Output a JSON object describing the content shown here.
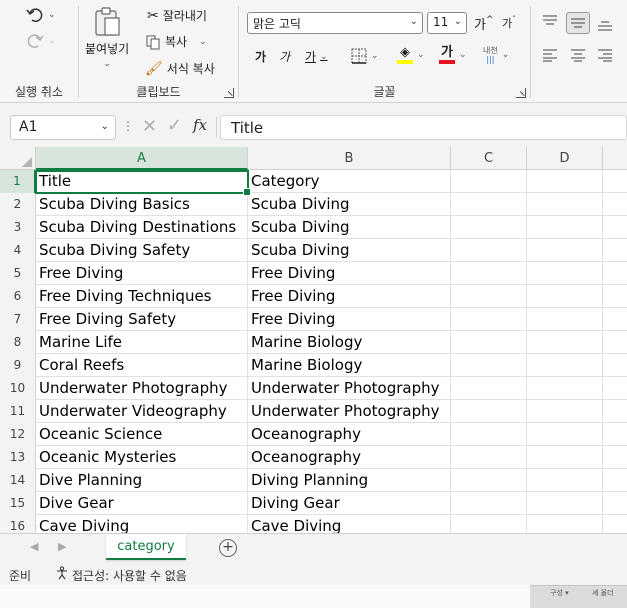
{
  "ribbon": {
    "undo_group": {
      "label": "실행 취소"
    },
    "clipboard": {
      "label": "클립보드",
      "paste_label": "붙여넣기",
      "cut_label": "잘라내기",
      "copy_label": "복사",
      "format_painter_label": "서식 복사"
    },
    "font": {
      "label": "글꼴",
      "font_name": "맑은 고딕",
      "font_size": "11",
      "grow_label": "가",
      "shrink_label": "가",
      "bold_label": "가",
      "italic_label": "가",
      "underline_label": "가",
      "font_color_label": "가",
      "phonetic_label": "내천",
      "font_color": "#e81123",
      "highlight_color": "#ffff00"
    }
  },
  "formula_bar": {
    "name_box": "A1",
    "formula": "Title",
    "fx_label": "fx"
  },
  "grid": {
    "columns": [
      "A",
      "B",
      "C",
      "D"
    ],
    "rows": [
      {
        "num": "1",
        "a": "Title",
        "b": "Category"
      },
      {
        "num": "2",
        "a": "Scuba Diving Basics",
        "b": "Scuba Diving"
      },
      {
        "num": "3",
        "a": "Scuba Diving Destinations",
        "b": "Scuba Diving"
      },
      {
        "num": "4",
        "a": "Scuba Diving Safety",
        "b": "Scuba Diving"
      },
      {
        "num": "5",
        "a": "Free Diving",
        "b": "Free Diving"
      },
      {
        "num": "6",
        "a": "Free Diving Techniques",
        "b": "Free Diving"
      },
      {
        "num": "7",
        "a": "Free Diving Safety",
        "b": "Free Diving"
      },
      {
        "num": "8",
        "a": "Marine Life",
        "b": "Marine Biology"
      },
      {
        "num": "9",
        "a": "Coral Reefs",
        "b": "Marine Biology"
      },
      {
        "num": "10",
        "a": "Underwater Photography",
        "b": "Underwater Photography"
      },
      {
        "num": "11",
        "a": "Underwater Videography",
        "b": "Underwater Photography"
      },
      {
        "num": "12",
        "a": "Oceanic Science",
        "b": "Oceanography"
      },
      {
        "num": "13",
        "a": "Oceanic Mysteries",
        "b": "Oceanography"
      },
      {
        "num": "14",
        "a": "Dive Planning",
        "b": "Diving Planning"
      },
      {
        "num": "15",
        "a": "Dive Gear",
        "b": "Diving Gear"
      },
      {
        "num": "16",
        "a": "Cave Diving",
        "b": "Cave Diving"
      }
    ]
  },
  "sheet_tabs": {
    "active": "category",
    "add_label": "+"
  },
  "status_bar": {
    "ready": "준비",
    "accessibility": "접근성: 사용할 수 없음"
  },
  "background_window": {
    "left_label": "구성 ▾",
    "right_label": "셰 올더"
  },
  "accent_color": "#107c41"
}
